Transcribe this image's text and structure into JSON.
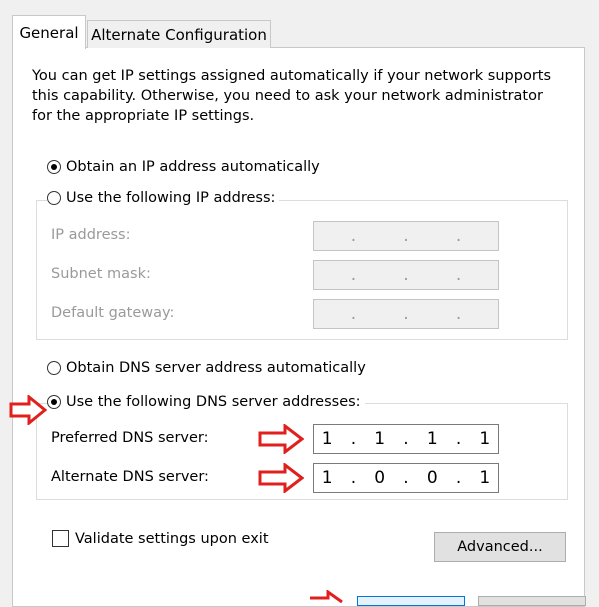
{
  "tabs": [
    {
      "label": "General"
    },
    {
      "label": "Alternate Configuration"
    }
  ],
  "description": "You can get IP settings assigned automatically if your network supports\nthis capability. Otherwise, you need to ask your network administrator\nfor the appropriate IP settings.",
  "ip_section": {
    "auto_label": "Obtain an IP address automatically",
    "auto_selected": true,
    "manual_label": "Use the following IP address:",
    "manual_selected": false,
    "fields": [
      {
        "label": "IP address:",
        "octets": [
          "",
          "",
          "",
          ""
        ]
      },
      {
        "label": "Subnet mask:",
        "octets": [
          "",
          "",
          "",
          ""
        ]
      },
      {
        "label": "Default gateway:",
        "octets": [
          "",
          "",
          "",
          ""
        ]
      }
    ]
  },
  "dns_section": {
    "auto_label": "Obtain DNS server address automatically",
    "auto_selected": false,
    "manual_label": "Use the following DNS server addresses:",
    "manual_selected": true,
    "preferred": {
      "label": "Preferred DNS server:",
      "octets": [
        "1",
        "1",
        "1",
        "1"
      ]
    },
    "alternate": {
      "label": "Alternate DNS server:",
      "octets": [
        "1",
        "0",
        "0",
        "1"
      ]
    }
  },
  "validate": {
    "label": "Validate settings upon exit",
    "checked": false
  },
  "advanced_button": "Advanced...",
  "colors": {
    "annotation_arrow": "#e0201c",
    "window_bg": "#f0f0f0",
    "focus_blue": "#0078d7"
  }
}
